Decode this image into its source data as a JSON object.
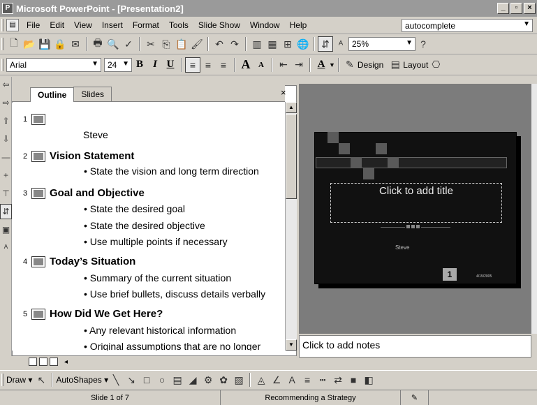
{
  "window": {
    "title": "Microsoft PowerPoint - [Presentation2]",
    "app_icon": "powerpoint-icon"
  },
  "menu": {
    "items": [
      "File",
      "Edit",
      "View",
      "Insert",
      "Format",
      "Tools",
      "Slide Show",
      "Window",
      "Help"
    ],
    "search_value": "autocomplete"
  },
  "standard_toolbar": {
    "zoom": "25%",
    "icons": [
      "new-icon",
      "open-icon",
      "save-icon",
      "permission-icon",
      "email-icon",
      "print-icon",
      "print-preview-icon",
      "spelling-icon",
      "cut-icon",
      "copy-icon",
      "paste-icon",
      "format-painter-icon",
      "undo-icon",
      "redo-icon",
      "insert-chart-icon",
      "insert-table-icon",
      "tables-borders-icon",
      "hyperlink-icon",
      "expand-all-icon",
      "show-formatting-icon",
      "help-icon"
    ]
  },
  "formatting_toolbar": {
    "font": "Arial",
    "size": "24",
    "bold": "B",
    "italic": "I",
    "underline": "U",
    "grow_font": "A",
    "shrink_font": "A",
    "font_color": "A",
    "design_label": "Design",
    "layout_label": "Layout"
  },
  "outline_pane": {
    "tabs": [
      "Outline",
      "Slides"
    ],
    "close": "×",
    "slides": [
      {
        "num": "1",
        "title": "",
        "bullets": [],
        "subtitle": "Steve"
      },
      {
        "num": "2",
        "title": "Vision Statement",
        "bullets": [
          "State the vision and long term direction"
        ]
      },
      {
        "num": "3",
        "title": "Goal and Objective",
        "bullets": [
          "State the desired goal",
          "State the desired objective",
          "Use multiple points if necessary"
        ]
      },
      {
        "num": "4",
        "title": "Today’s Situation",
        "bullets": [
          "Summary of the current situation",
          "Use brief bullets, discuss details verbally"
        ]
      },
      {
        "num": "5",
        "title": "How Did We Get Here?",
        "bullets": [
          "Any relevant historical information",
          "Original assumptions that are no longer"
        ]
      }
    ]
  },
  "slide_preview": {
    "title_placeholder": "Click to add title",
    "subtitle": "Steve",
    "page_number": "1",
    "date": "4/15/2005"
  },
  "notes": {
    "placeholder": "Click to add notes"
  },
  "drawing_toolbar": {
    "draw": "Draw",
    "autoshapes": "AutoShapes"
  },
  "status_bar": {
    "slide": "Slide 1 of 7",
    "design": "Recommending a Strategy"
  }
}
